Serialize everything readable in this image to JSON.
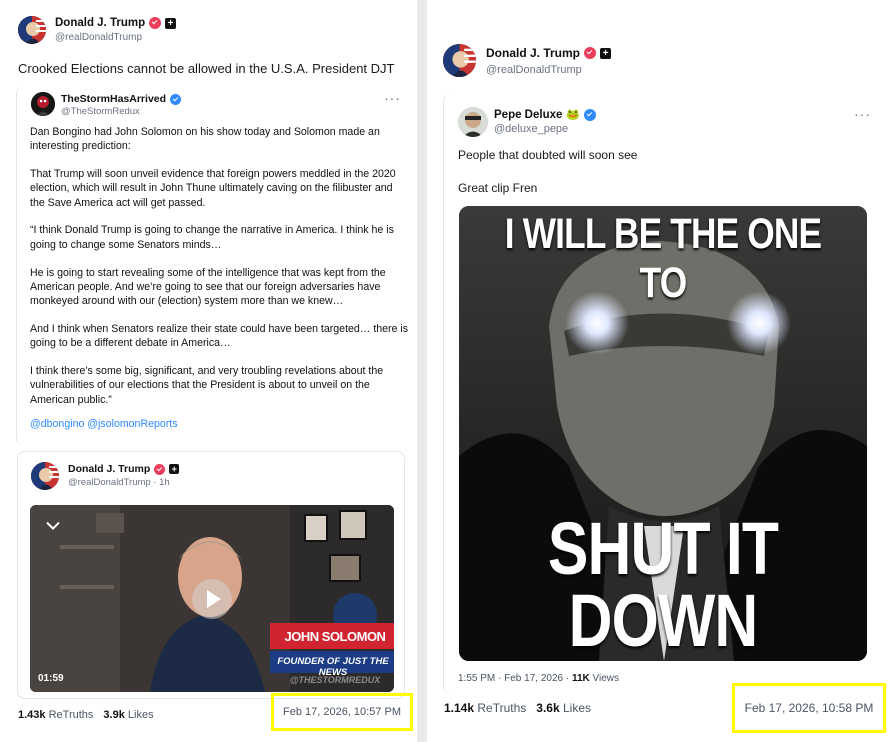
{
  "left_post": {
    "author_name": "Donald J. Trump",
    "author_handle": "@realDonaldTrump",
    "text": "Crooked Elections cannot be allowed in the U.S.A. President DJT",
    "quoted": {
      "author_name": "TheStormHasArrived",
      "author_handle": "@TheStormRedux",
      "paragraphs": [
        "Dan Bongino had John Solomon on his show today and Solomon made an interesting prediction:",
        "That Trump will soon unveil evidence that foreign powers meddled in the 2020 election, which will result in John Thune ultimately caving on the filibuster and the Save America act will get passed.",
        "“I think Donald Trump is going to change the narrative in America. I think he is going to change some Senators minds…",
        "He is going to start revealing some of the intelligence that was kept from the American people. And we’re going to see that our foreign adversaries have monkeyed around with our (election) system more than we knew…",
        "And I think when Senators realize their state could have been targeted… there is going to be a different debate in America…",
        "I think there’s some big, significant, and very troubling revelations about the vulnerabilities of our elections that the President is about to unveil on the American public.”"
      ],
      "mentions": "@dbongino @jsolomonReports"
    },
    "embedded": {
      "author_name": "Donald J. Trump",
      "author_handle": "@realDonaldTrump · 1h",
      "video_name_tag": "JOHN SOLOMON",
      "video_subtitle": "FOUNDER OF JUST THE NEWS",
      "video_watermark": "@THESTORMREDUX",
      "video_duration": "01:59"
    },
    "retruths_count": "1.43k",
    "retruths_label": "ReTruths",
    "likes_count": "3.9k",
    "likes_label": "Likes",
    "timestamp": "Feb 17, 2026, 10:57 PM"
  },
  "right_post": {
    "author_name": "Donald J. Trump",
    "author_handle": "@realDonaldTrump",
    "quoted": {
      "author_name": "Pepe Deluxe",
      "author_emoji": "🐸",
      "author_handle": "@deluxe_pepe",
      "line1": "People that doubted will soon see",
      "line2": "Great clip Fren",
      "meme_top": "I WILL BE THE ONE TO",
      "meme_bottom_1": "SHUT IT",
      "meme_bottom_2": "DOWN",
      "meta_time": "1:55 PM · Feb 17, 2026 · ",
      "meta_views": "11K",
      "meta_views_label": " Views"
    },
    "retruths_count": "1.14k",
    "retruths_label": "ReTruths",
    "likes_count": "3.6k",
    "likes_label": "Likes",
    "timestamp": "Feb 17, 2026, 10:58 PM"
  },
  "colors": {
    "highlight": "#ffff00",
    "verified_red": "#ea3e5c",
    "verified_blue": "#2f8bff",
    "link": "#2f8bff"
  }
}
